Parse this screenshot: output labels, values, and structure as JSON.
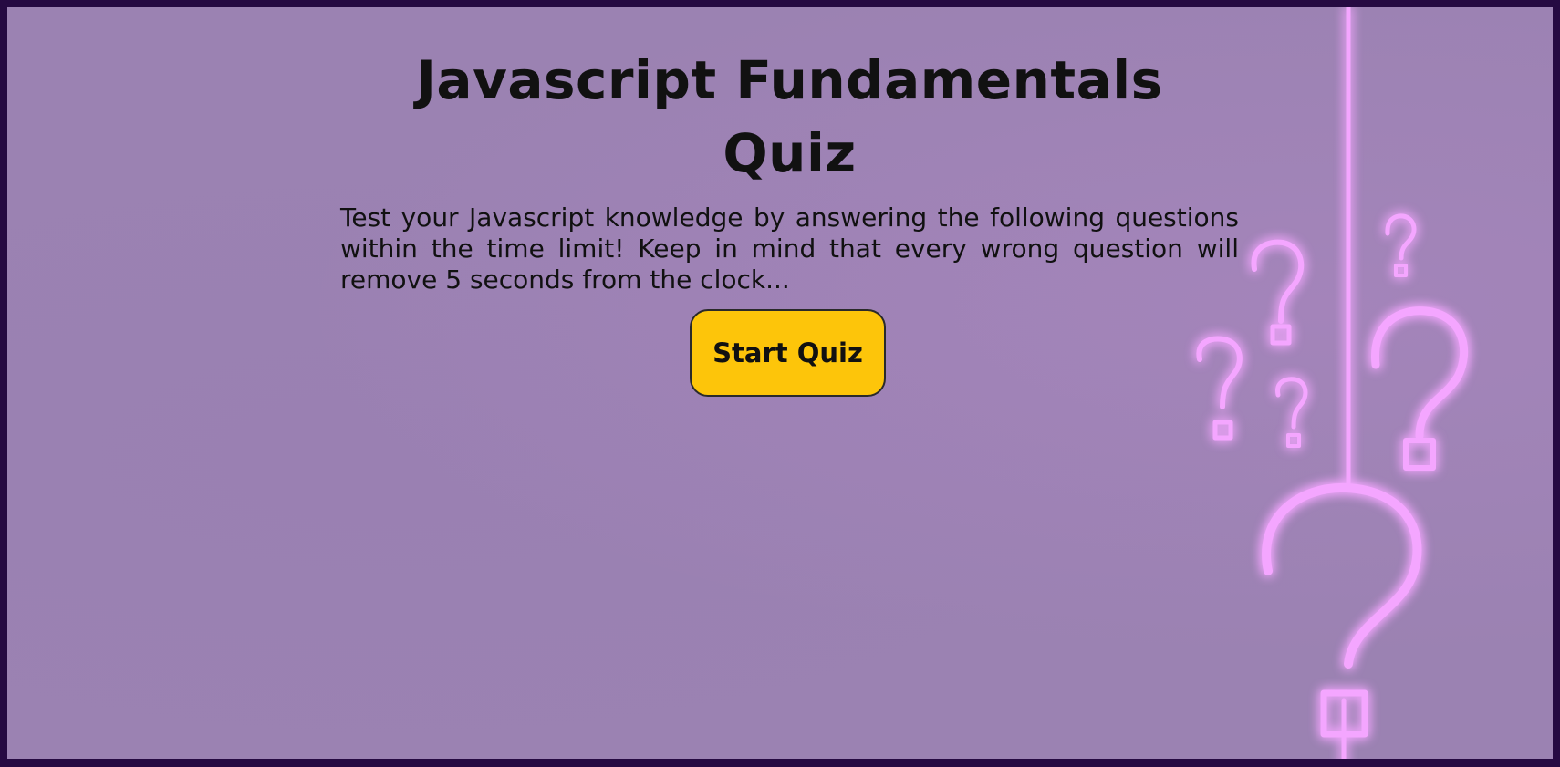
{
  "page": {
    "title": "Javascript Fundamentals Quiz",
    "description": "Test your Javascript knowledge by answering the following questions within the time limit! Keep in mind that every wrong question will remove 5 seconds from the clock...",
    "start_button_label": "Start Quiz"
  },
  "theme": {
    "background": "#9b82b2",
    "frame_border": "#260a42",
    "button_color": "#fdc50a",
    "neon_pink": "#f4a6ff"
  },
  "decoration": {
    "icon": "neon-question-marks-icon"
  }
}
